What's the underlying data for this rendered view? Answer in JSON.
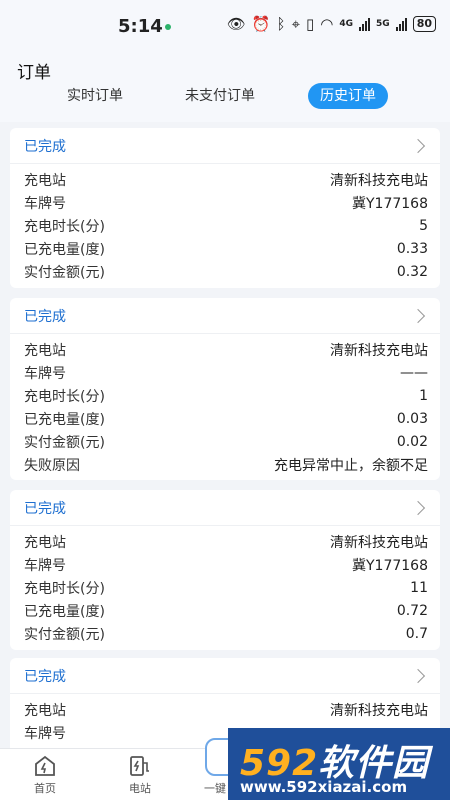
{
  "status_bar": {
    "time": "5:14",
    "network_4g": "4G",
    "network_5g": "5G",
    "battery": "80",
    "icons": [
      "eye-icon",
      "alarm-icon",
      "bluetooth-icon",
      "location-icon",
      "vibrate-icon",
      "wifi-icon"
    ]
  },
  "header": {
    "title": "订单",
    "tabs": [
      {
        "label": "实时订单",
        "active": false
      },
      {
        "label": "未支付订单",
        "active": false
      },
      {
        "label": "历史订单",
        "active": true
      }
    ]
  },
  "orders": [
    {
      "status": "已完成",
      "rows": [
        {
          "label": "充电站",
          "value": "清新科技充电站"
        },
        {
          "label": "车牌号",
          "value": "冀Y177168"
        },
        {
          "label": "充电时长(分)",
          "value": "5"
        },
        {
          "label": "已充电量(度)",
          "value": "0.33"
        },
        {
          "label": "实付金额(元)",
          "value": "0.32"
        }
      ]
    },
    {
      "status": "已完成",
      "rows": [
        {
          "label": "充电站",
          "value": "清新科技充电站"
        },
        {
          "label": "车牌号",
          "value": "——"
        },
        {
          "label": "充电时长(分)",
          "value": "1"
        },
        {
          "label": "已充电量(度)",
          "value": "0.03"
        },
        {
          "label": "实付金额(元)",
          "value": "0.02"
        },
        {
          "label": "失败原因",
          "value": "充电异常中止，余额不足"
        }
      ]
    },
    {
      "status": "已完成",
      "rows": [
        {
          "label": "充电站",
          "value": "清新科技充电站"
        },
        {
          "label": "车牌号",
          "value": "冀Y177168"
        },
        {
          "label": "充电时长(分)",
          "value": "11"
        },
        {
          "label": "已充电量(度)",
          "value": "0.72"
        },
        {
          "label": "实付金额(元)",
          "value": "0.7"
        }
      ]
    },
    {
      "status": "已完成",
      "rows": [
        {
          "label": "充电站",
          "value": "清新科技充电站"
        },
        {
          "label": "车牌号",
          "value": ""
        }
      ]
    }
  ],
  "bottom_nav": {
    "items": [
      {
        "label": "首页",
        "icon": "home-icon"
      },
      {
        "label": "电站",
        "icon": "charging-station-icon"
      },
      {
        "label": "一键",
        "icon": "scan-icon"
      }
    ]
  },
  "watermark": {
    "prefix": "592",
    "text": "软件园",
    "url": "www.592xiazai.com"
  },
  "colors": {
    "accent": "#2196f3",
    "status_text": "#1e6fd0",
    "background": "#f2f4f8"
  }
}
